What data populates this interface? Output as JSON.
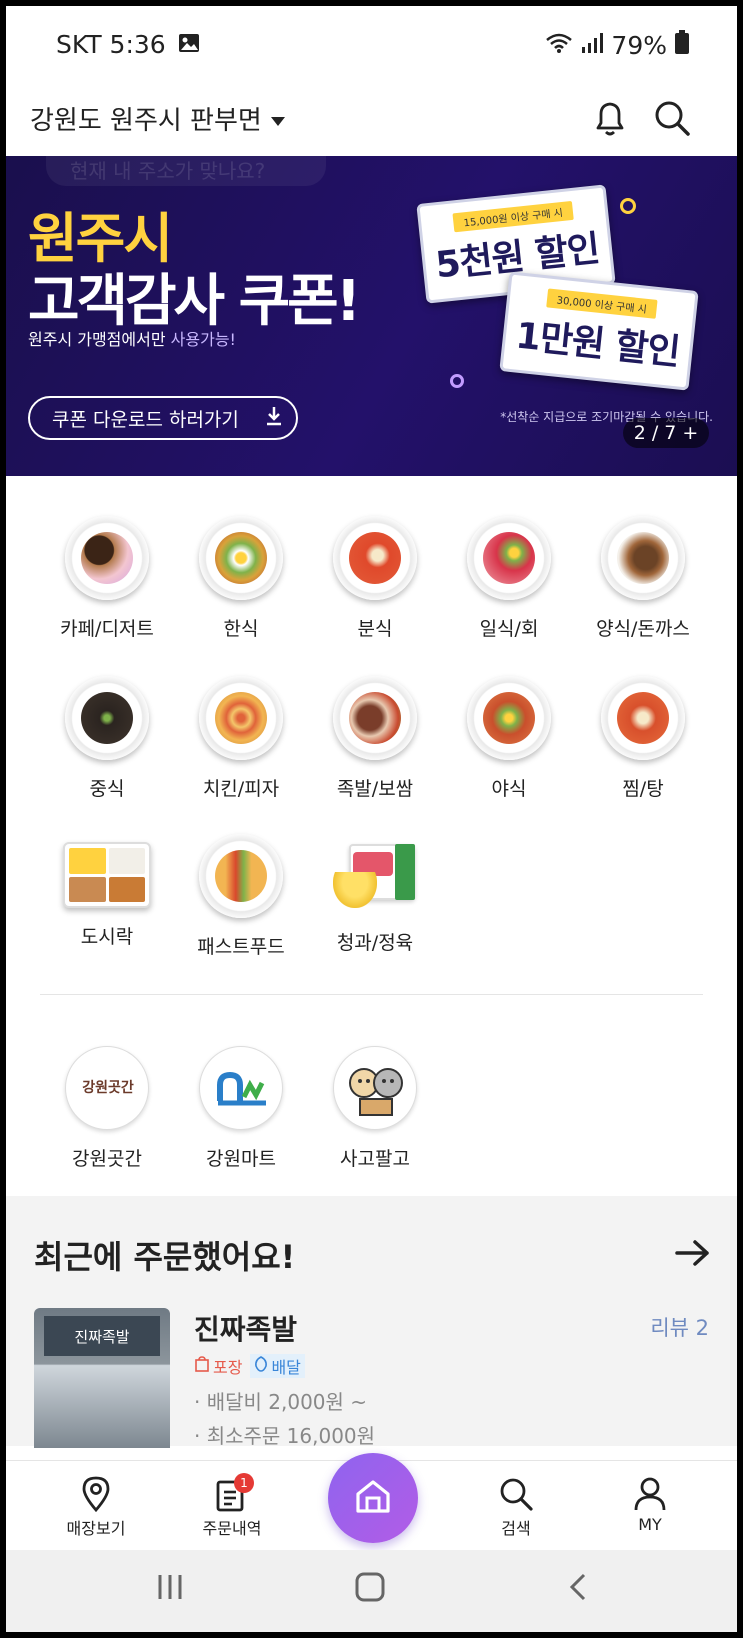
{
  "status_bar": {
    "carrier_time": "SKT 5:36",
    "battery": "79%"
  },
  "header": {
    "location": "강원도 원주시 판부면"
  },
  "banner": {
    "ghost_text": "현재 내 주소가 맞나요?",
    "title_line1": "원주시",
    "title_line2": "고객감사 쿠폰!",
    "subtitle_prefix": "원주시 가맹점에서만 ",
    "subtitle_highlight": "사용가능!",
    "coupon1_condition": "15,000원 이상 구매 시",
    "coupon1_amount": "5천원 할인",
    "coupon2_condition": "30,000 이상 구매 시",
    "coupon2_amount": "1만원 할인",
    "download_button": "쿠폰 다운로드 하러가기",
    "note": "*선착순 지급으로 조기마감될 수 있습니다.",
    "page_indicator": "2 / 7 +"
  },
  "categories": [
    {
      "label": "카페/디저트"
    },
    {
      "label": "한식"
    },
    {
      "label": "분식"
    },
    {
      "label": "일식/회"
    },
    {
      "label": "양식/돈까스"
    },
    {
      "label": "중식"
    },
    {
      "label": "치킨/피자"
    },
    {
      "label": "족발/보쌈"
    },
    {
      "label": "야식"
    },
    {
      "label": "찜/탕"
    },
    {
      "label": "도시락"
    },
    {
      "label": "패스트푸드"
    },
    {
      "label": "청과/정육"
    }
  ],
  "category_colors": {
    "cafe": "#b37a4c",
    "korean": "#d9a23a",
    "snack": "#e0492b",
    "japanese": "#d8344a",
    "western": "#6b4326",
    "chinese": "#2b2420",
    "chicken_pizza": "#e0633a",
    "jokbal": "#7a3d2a",
    "late_night": "#c94f2c",
    "stew": "#d8502c",
    "lunchbox": "#c97b35",
    "fastfood": "#d9482c",
    "produce": "#f1c232"
  },
  "partners": [
    {
      "label": "강원곳간",
      "logo_text": "강원곳간"
    },
    {
      "label": "강원마트"
    },
    {
      "label": "사고팔고"
    }
  ],
  "recent": {
    "title": "최근에 주문했어요!",
    "store": {
      "name": "진짜족발",
      "review": "리뷰 2",
      "tag_pack": "포장",
      "tag_delivery": "배달",
      "delivery_fee": "· 배달비 2,000원 ~",
      "min_order": "· 최소주문 16,000원",
      "sign_text": "진짜족발"
    }
  },
  "nav": {
    "store": "매장보기",
    "orders": "주문내역",
    "orders_badge": "1",
    "search": "검색",
    "my": "MY"
  },
  "accent_color": "#9b5fe9"
}
